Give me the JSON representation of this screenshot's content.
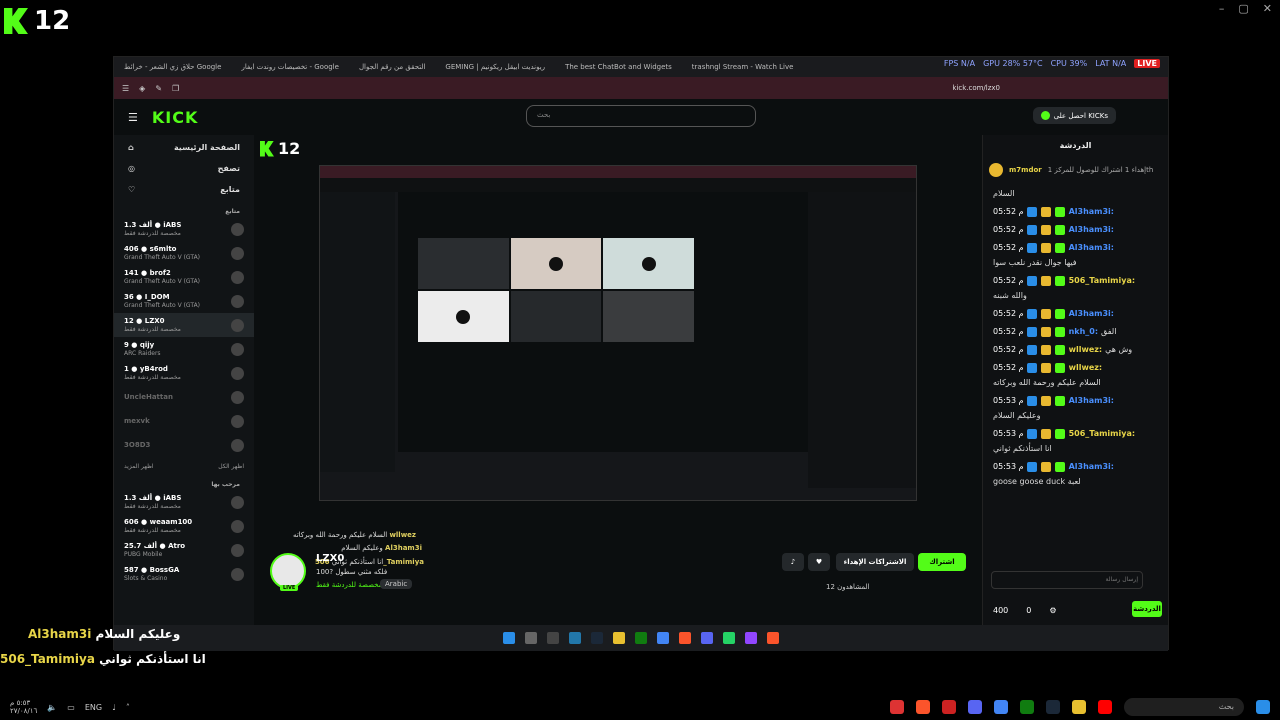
{
  "overlay_logo": {
    "num": "12"
  },
  "window_controls": [
    "–",
    "▢",
    "✕"
  ],
  "browser": {
    "tabs": [
      "حلاق زي الشعر - خرائط Google",
      "تخصيصات روندت ايفار - Google",
      "التحقق من رقم الجوال",
      "GEMING | ريونديت ابيقل ريكونيم",
      "The best ChatBot and Widgets",
      "trashngl Stream - Watch Live"
    ],
    "url": "kick.com/lzx0",
    "hud": {
      "fps": "FPS N/A",
      "gpu": "GPU 28% 57°C",
      "cpu": "CPU 39%",
      "lat": "LAT N/A",
      "live": "LIVE"
    }
  },
  "kick": {
    "search_placeholder": "بحث",
    "get_kicks": "احصل على KICKs",
    "nav": {
      "home": "الصفحة الرئيسية",
      "browse": "تصفح",
      "following": "متابع"
    },
    "following_head": "متابع",
    "channels": [
      {
        "name": "iABS",
        "viewers": "1.3 ألف",
        "cat": "مخصصة للدردشة فقط"
      },
      {
        "name": "s6mlto",
        "viewers": "406",
        "cat": "Grand Theft Auto V (GTA)"
      },
      {
        "name": "brof2",
        "viewers": "141",
        "cat": "Grand Theft Auto V (GTA)"
      },
      {
        "name": "I_DOM",
        "viewers": "36",
        "cat": "Grand Theft Auto V (GTA)"
      },
      {
        "name": "LZX0",
        "viewers": "12",
        "cat": "مخصصة للدردشة فقط"
      },
      {
        "name": "qijy",
        "viewers": "9",
        "cat": "ARC Raiders"
      },
      {
        "name": "yB4rod",
        "viewers": "1",
        "cat": "مخصصة للدردشة فقط"
      }
    ],
    "offline": [
      "UncleHattan",
      "mexvk",
      "3O8D3"
    ],
    "show_more": "اظهر المزيد",
    "show_all": "اظهر الكل",
    "recommended_head": "مرحب بها",
    "recommended": [
      {
        "name": "iABS",
        "viewers": "1.3 ألف",
        "cat": "مخصصة للدردشة فقط"
      },
      {
        "name": "weaam100",
        "viewers": "606",
        "cat": "مخصصة للدردشة فقط"
      },
      {
        "name": "Atro",
        "viewers": "25.7 ألف",
        "cat": "PUBG Mobile"
      },
      {
        "name": "BossGA",
        "viewers": "587",
        "cat": "Slots & Casino"
      }
    ],
    "stream_overlay": [
      {
        "name": "wllwez",
        "msg": "السلام عليكم ورحمة الله وبركاته"
      },
      {
        "name": "Al3ham3i",
        "msg": "وعليكم السلام"
      },
      {
        "name": "506_Tamimiya",
        "msg": "انا استأذنكم ثواني"
      }
    ],
    "channel": {
      "name": "LZX0",
      "title": "100? فلكه مثني سطول",
      "category": "مخصصة للدردشة فقط",
      "language": "Arabic",
      "live": "LIVE",
      "follow": "اشتراك",
      "subs": "الاشتراكات الإهداء",
      "viewers": "المشاهدون 12"
    }
  },
  "chat": {
    "head": "الدردشة",
    "pinned_user": "m7mdor",
    "pinned_text": "إهداء 1 اشتراك للوصول للمركز 1th",
    "greet": "السلام",
    "messages": [
      {
        "time": "05:52 م",
        "user": "Al3ham3i:",
        "text": "",
        "color": "#4a90ff"
      },
      {
        "time": "05:52 م",
        "user": "Al3ham3i:",
        "text": "",
        "color": "#4a90ff"
      },
      {
        "time": "05:52 م",
        "user": "Al3ham3i:",
        "text": "فيها جوال نقدر نلعب سوا",
        "color": "#4a90ff"
      },
      {
        "time": "05:52 م",
        "user": "506_Tamimiya:",
        "text": "والله شبنه",
        "color": "#e8d548"
      },
      {
        "time": "05:52 م",
        "user": "Al3ham3i:",
        "text": "",
        "color": "#4a90ff"
      },
      {
        "time": "05:52 م",
        "user": "nkh_0:",
        "text": "الفق",
        "color": "#4a90ff"
      },
      {
        "time": "05:52 م",
        "user": "wllwez:",
        "text": "وش هي",
        "color": "#e8d548"
      },
      {
        "time": "05:52 م",
        "user": "wllwez:",
        "text": "السلام عليكم ورحمة الله وبركاته",
        "color": "#e8d548"
      },
      {
        "time": "05:53 م",
        "user": "Al3ham3i:",
        "text": "وعليكم السلام",
        "color": "#4a90ff"
      },
      {
        "time": "05:53 م",
        "user": "506_Tamimiya:",
        "text": "انا استأذنكم ثواني",
        "color": "#e8d548"
      },
      {
        "time": "05:53 م",
        "user": "Al3ham3i:",
        "text": "goose goose duck لعبة",
        "color": "#4a90ff"
      }
    ],
    "input_placeholder": "إرسال رسالة",
    "send": "الدردشة",
    "kicks_count": "400",
    "zero": "0"
  },
  "bottom_overlay": [
    {
      "name": "Al3ham3i",
      "msg": "وعليكم السلام"
    },
    {
      "name": "506_Tamimiya",
      "msg": "انا استأذنكم ثواني"
    }
  ],
  "system": {
    "clock": "٥:٥٣ م",
    "date": "٢٧/٠٨/١٦",
    "lang": "ENG",
    "search": "بحث"
  }
}
